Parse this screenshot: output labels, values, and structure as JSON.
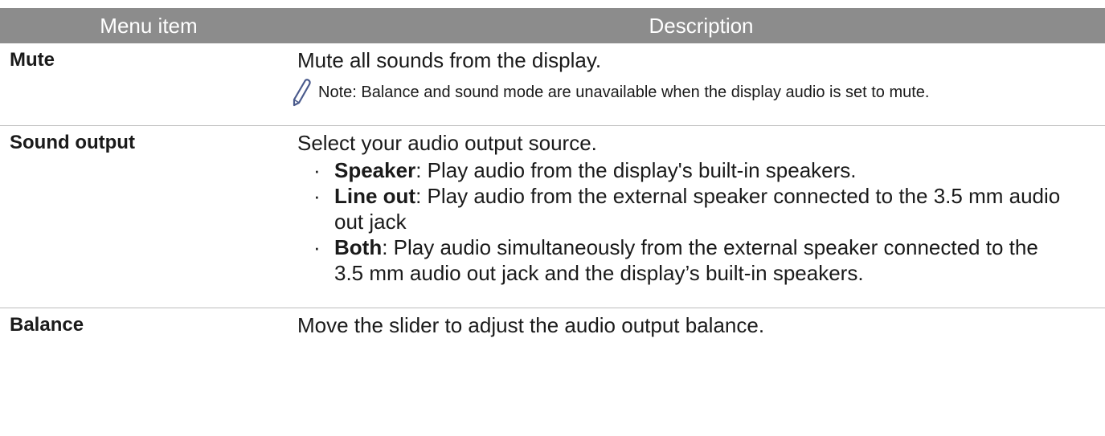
{
  "table": {
    "headers": {
      "item": "Menu item",
      "description": "Description"
    },
    "rows": {
      "mute": {
        "item": "Mute",
        "description": "Mute all sounds from the display.",
        "note": "Note: Balance and sound mode are unavailable when the display audio is set to mute."
      },
      "sound_output": {
        "item": "Sound output",
        "description": "Select your audio output source.",
        "options": [
          {
            "label": "Speaker",
            "text": ": Play audio from the display's built-in speakers."
          },
          {
            "label": "Line out",
            "text": ": Play audio from the external speaker connected to the 3.5 mm audio out jack"
          },
          {
            "label": "Both",
            "text": ": Play audio simultaneously from the external speaker connected to the 3.5 mm audio out jack and the display’s built-in speakers."
          }
        ]
      },
      "balance": {
        "item": "Balance",
        "description": "Move the slider to adjust the audio output balance."
      }
    }
  },
  "colors": {
    "header_bg": "#8c8c8c",
    "header_text": "#ffffff",
    "note_icon": "#4a5a8c"
  },
  "icons": {
    "note": "pencil-icon",
    "bullet": "·"
  }
}
